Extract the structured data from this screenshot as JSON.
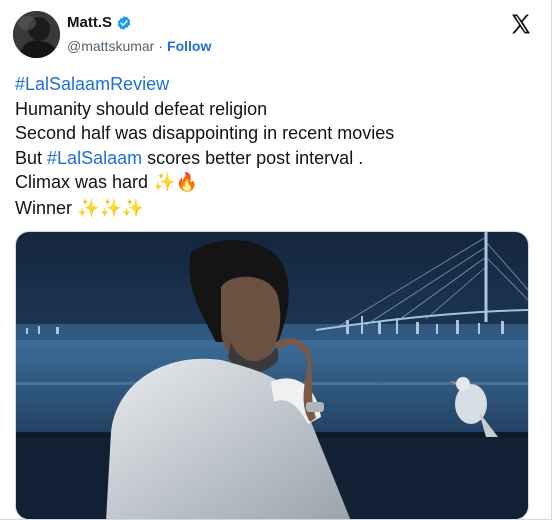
{
  "author": {
    "name": "Matt.S",
    "handle": "@mattskumar",
    "separator": "·",
    "follow_label": "Follow"
  },
  "tweet": {
    "lines": [
      {
        "parts": [
          {
            "type": "tag",
            "text": "#LalSalaamReview"
          }
        ]
      },
      {
        "parts": [
          {
            "type": "text",
            "text": "Humanity should defeat religion"
          }
        ]
      },
      {
        "parts": [
          {
            "type": "text",
            "text": "Second half was disappointing in recent movies"
          }
        ]
      },
      {
        "parts": [
          {
            "type": "text",
            "text": "But "
          },
          {
            "type": "tag",
            "text": "#LalSalaam"
          },
          {
            "type": "text",
            "text": " scores better post interval ."
          }
        ]
      },
      {
        "parts": [
          {
            "type": "text",
            "text": "Climax was hard "
          },
          {
            "type": "emoji",
            "text": "✨",
            "icon": "sparkles-icon"
          },
          {
            "type": "emoji",
            "text": "🔥",
            "icon": "fire-icon"
          }
        ]
      },
      {
        "parts": [
          {
            "type": "text",
            "text": "Winner "
          },
          {
            "type": "emoji",
            "text": "✨",
            "icon": "sparkles-icon"
          },
          {
            "type": "emoji",
            "text": "✨",
            "icon": "sparkles-icon"
          },
          {
            "type": "emoji",
            "text": "✨",
            "icon": "sparkles-icon"
          }
        ]
      }
    ]
  },
  "colors": {
    "link": "#1d6fd6",
    "verified": "#1d9bf0",
    "text": "#0f1419",
    "muted": "#536471"
  }
}
